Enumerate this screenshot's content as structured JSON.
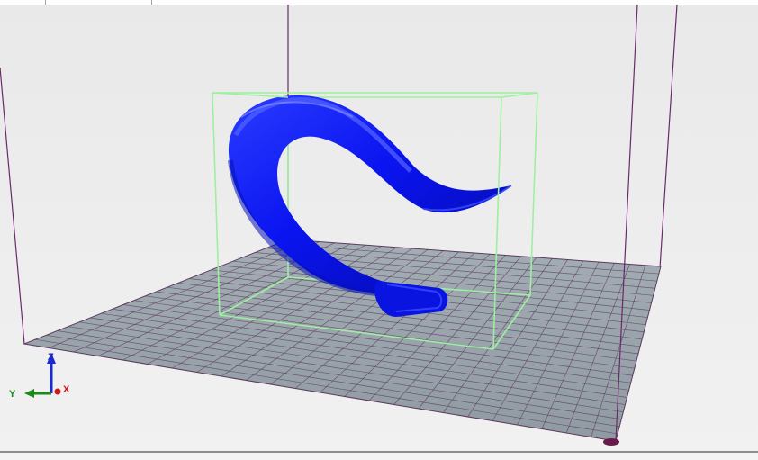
{
  "viewport": {
    "background_color": "#eeeeee",
    "build_plate": {
      "fill_color": "#9aa6ae",
      "grid_color": "#5d3a5d",
      "grid_divisions": 24
    },
    "build_volume_line_color": "#6a2a6a",
    "bounding_box_color": "#9ef0a0",
    "model": {
      "color": "#0a14f0",
      "shape": "curved-spiral-horn"
    },
    "origin_marker_color": "#6a1a4a"
  },
  "axis_indicator": {
    "z_label": "Z",
    "y_label": "Y",
    "x_label": "X",
    "z_color": "#1a2ad0",
    "y_color": "#1a8a1a",
    "x_color": "#c81a1a"
  }
}
